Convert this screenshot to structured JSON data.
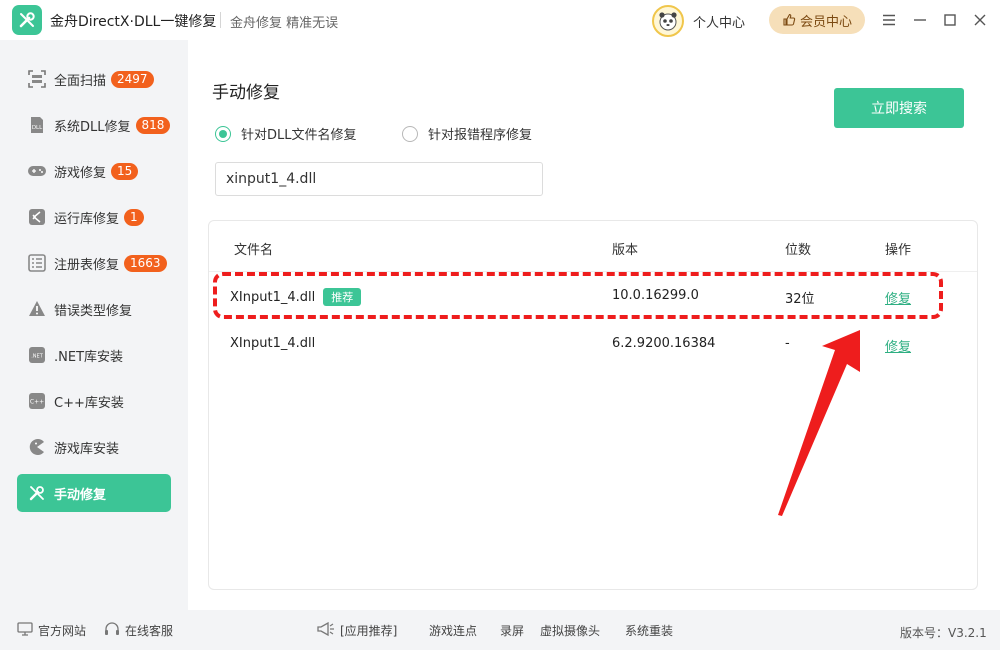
{
  "app": {
    "title": "金舟DirectX·DLL一键修复",
    "slogan": "金舟修复 精准无误",
    "user_center": "个人中心",
    "vip_label": "会员中心"
  },
  "sidebar": {
    "items": [
      {
        "label": "全面扫描",
        "badge": "2497",
        "icon": "scan-icon"
      },
      {
        "label": "系统DLL修复",
        "badge": "818",
        "icon": "dll-icon"
      },
      {
        "label": "游戏修复",
        "badge": "15",
        "icon": "gamepad-icon"
      },
      {
        "label": "运行库修复",
        "badge": "1",
        "icon": "visual-studio-icon"
      },
      {
        "label": "注册表修复",
        "badge": "1663",
        "icon": "registry-icon"
      },
      {
        "label": "错误类型修复",
        "icon": "warning-icon"
      },
      {
        "label": ".NET库安装",
        "icon": "dotnet-icon"
      },
      {
        "label": "C++库安装",
        "icon": "cpp-icon"
      },
      {
        "label": "游戏库安装",
        "icon": "pacman-icon"
      },
      {
        "label": "手动修复",
        "icon": "tools-icon",
        "active": true
      }
    ]
  },
  "main": {
    "title": "手动修复",
    "search_button": "立即搜索",
    "radio_by_filename": "针对DLL文件名修复",
    "radio_by_program": "针对报错程序修复",
    "search_value": "xinput1_4.dll",
    "table": {
      "headers": {
        "name": "文件名",
        "version": "版本",
        "bits": "位数",
        "action": "操作"
      },
      "rows": [
        {
          "name": "XInput1_4.dll",
          "tag": "推荐",
          "version": "10.0.16299.0",
          "bits": "32位",
          "action": "修复"
        },
        {
          "name": "XInput1_4.dll",
          "version": "6.2.9200.16384",
          "bits": "-",
          "action": "修复"
        }
      ]
    }
  },
  "footer": {
    "official_site": "官方网站",
    "online_service": "在线客服",
    "app_recommend": "[应用推荐]",
    "links": [
      "游戏连点",
      "录屏",
      "虚拟摄像头",
      "系统重装"
    ],
    "version": "版本号：V3.2.1"
  },
  "colors": {
    "accent": "#3cc596",
    "badge": "#f2611d",
    "annotation": "#ee1d1d",
    "vip_bg": "#f6dfb9"
  }
}
